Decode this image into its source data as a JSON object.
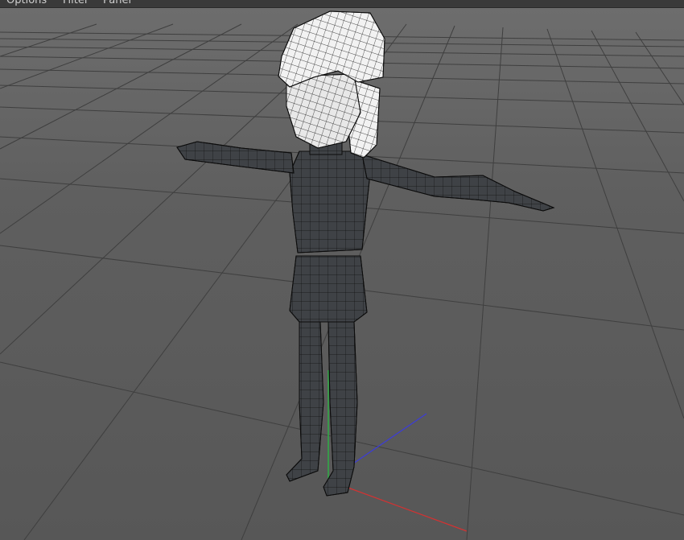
{
  "menu": {
    "items": [
      {
        "label": "Options"
      },
      {
        "label": "Filter"
      },
      {
        "label": "Panel"
      }
    ]
  },
  "viewport": {
    "background_color": "#5c5c5c",
    "grid_color": "#3e3e3e",
    "model_fill_color": "#3f4246",
    "hair_fill_color": "#f2f2f2",
    "wire_color": "#111111",
    "axis_x_color": "#d33232",
    "axis_y_color": "#2fae45",
    "axis_z_color": "#3c3cd8"
  }
}
